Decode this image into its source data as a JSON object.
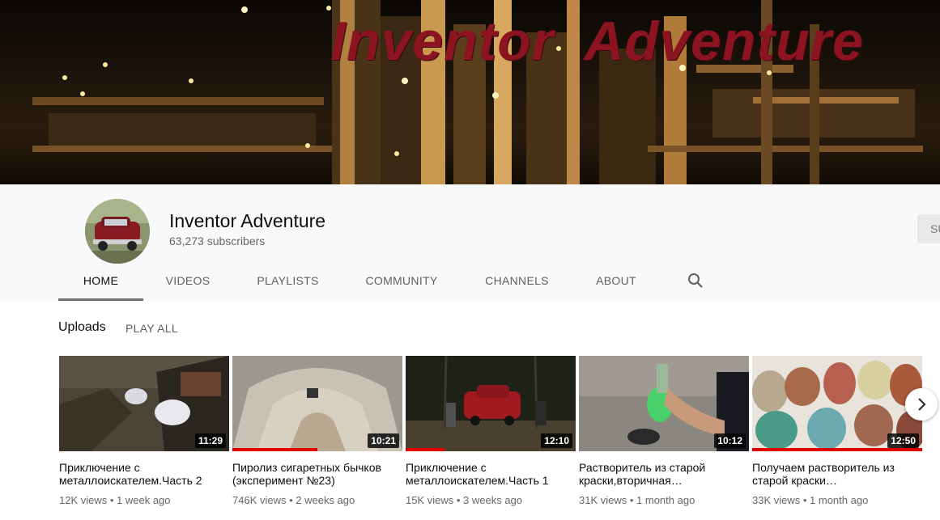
{
  "banner": {
    "title": "Inventor  Adventure"
  },
  "channel": {
    "name": "Inventor Adventure",
    "subscribers": "63,273 subscribers",
    "subscribe_label": "SUBSCRIBE"
  },
  "tabs": [
    {
      "label": "HOME"
    },
    {
      "label": "VIDEOS"
    },
    {
      "label": "PLAYLISTS"
    },
    {
      "label": "COMMUNITY"
    },
    {
      "label": "CHANNELS"
    },
    {
      "label": "ABOUT"
    }
  ],
  "icons": {
    "search": "search-icon",
    "next": "chevron-right-icon"
  },
  "uploads": {
    "title": "Uploads",
    "play_all": "PLAY ALL"
  },
  "videos": [
    {
      "title": "Приключение с металлоискателем.Часть 2",
      "meta": "12K views • 1 week ago",
      "duration": "11:29",
      "watched_fraction": 0
    },
    {
      "title": "Пиролиз сигаретных бычков (эксперимент №23)",
      "meta": "746K views • 2 weeks ago",
      "duration": "10:21",
      "watched_fraction": 0.5
    },
    {
      "title": "Приключение с металлоискателем.Часть 1",
      "meta": "15K views • 3 weeks ago",
      "duration": "12:10",
      "watched_fraction": 0.23
    },
    {
      "title": "Растворитель из старой краски,вторичная…",
      "meta": "31K views • 1 month ago",
      "duration": "10:12",
      "watched_fraction": 0
    },
    {
      "title": "Получаем растворитель из старой краски…",
      "meta": "33K views • 1 month ago",
      "duration": "12:50",
      "watched_fraction": 1
    }
  ],
  "colors": {
    "banner_title": "#8c1320",
    "progress": "#e00000",
    "active_tab_underline": "#707070"
  }
}
